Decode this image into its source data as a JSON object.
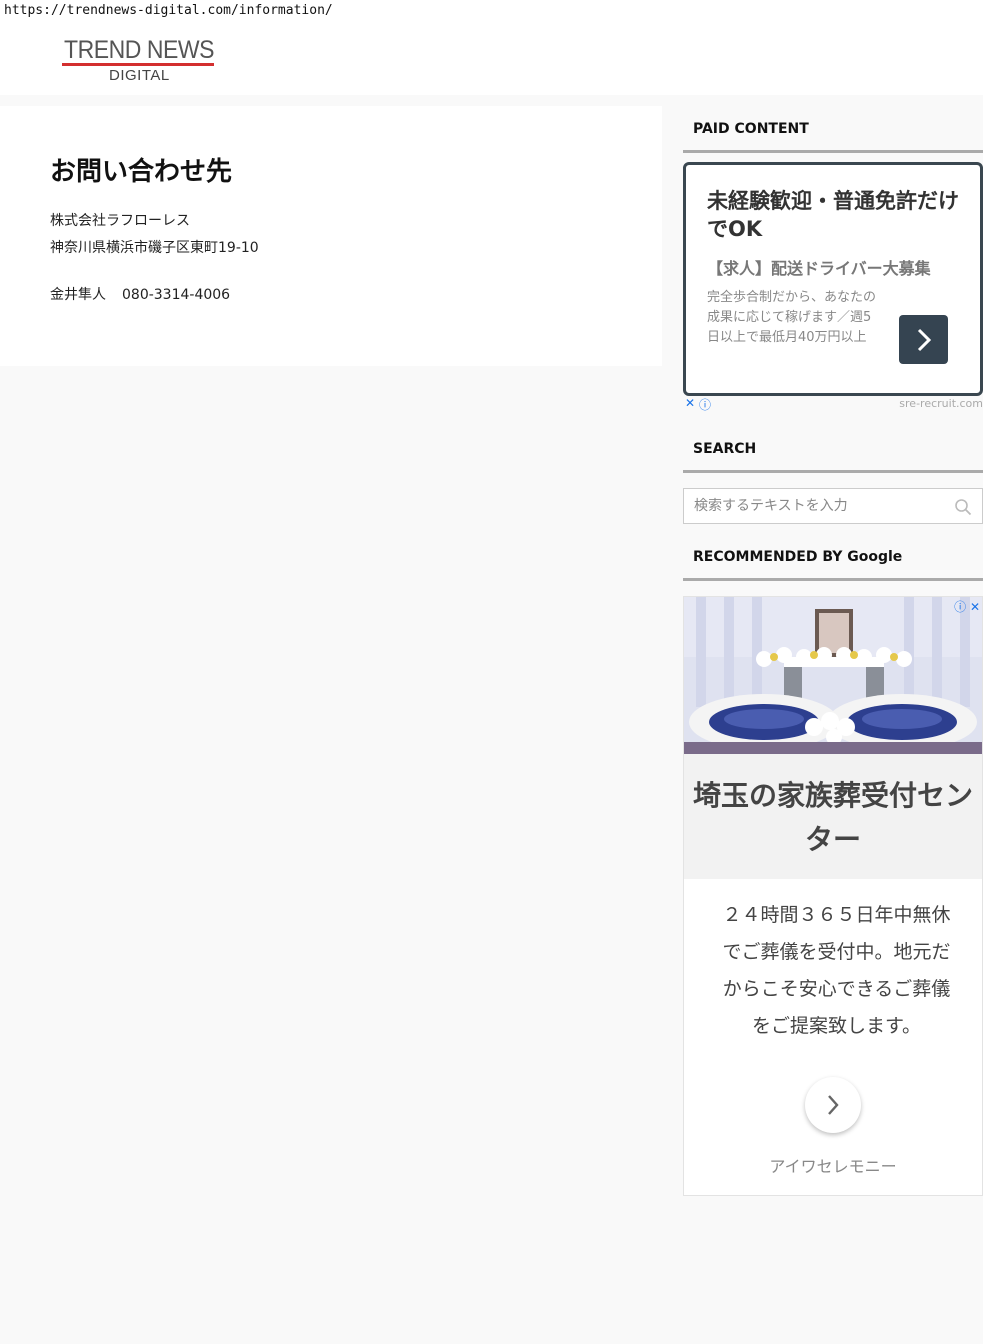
{
  "browser": {
    "url": "https://trendnews-digital.com/information/"
  },
  "site": {
    "logo_main": "TREND NEWS",
    "logo_sub": "DIGITAL",
    "logo_accent_color": "#d32f2f"
  },
  "main": {
    "title": "お問い合わせ先",
    "company": "株式会社ラフローレス",
    "address": "神奈川県横浜市磯子区東町19-10",
    "contact_name": "金井隼人",
    "phone": "080-3314-4006"
  },
  "sidebar": {
    "paid_content": {
      "title": "PAID CONTENT",
      "ad": {
        "headline": "未経験歓迎・普通免許だけでOK",
        "subhead": "【求人】配送ドライバー大募集",
        "body": "完全歩合制だから、あなたの成果に応じて稼げます／週5日以上で最低月40万円以上",
        "button_icon": "chevron-right-icon",
        "close_glyph": "✕",
        "info_glyph": "ⓘ",
        "domain": "sre-recruit.com",
        "accent_color": "#354451"
      }
    },
    "search": {
      "title": "SEARCH",
      "placeholder": "検索するテキストを入力",
      "icon": "search-icon"
    },
    "recommended": {
      "title": "RECOMMENDED BY Google",
      "ad": {
        "image": "funeral-altar-flowers-image",
        "info_glyph": "ⓘ",
        "close_glyph": "✕",
        "title": "埼玉の家族葬受付センター",
        "description": "２４時間３６５日年中無休でご葬儀を受付中。地元だからこそ安心できるご葬儀をご提案致します。",
        "button_icon": "chevron-right-icon",
        "brand": "アイワセレモニー"
      }
    }
  }
}
